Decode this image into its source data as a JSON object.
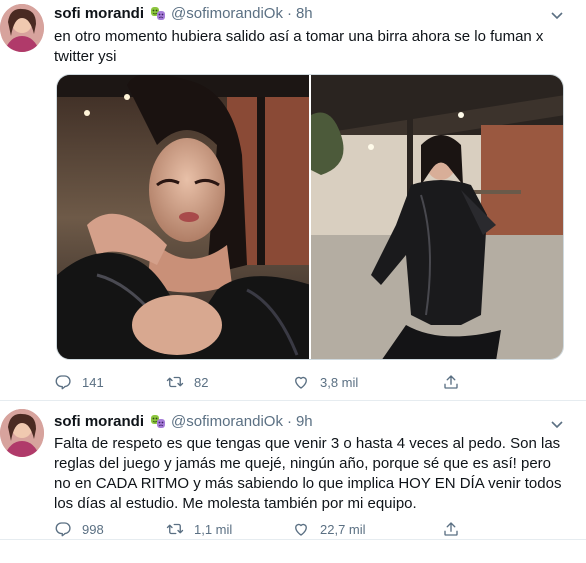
{
  "tweets": [
    {
      "author_name": "sofi morandi",
      "author_handle": "@sofimorandiOk",
      "separator": "·",
      "time": "8h",
      "text": "en otro momento hubiera salido así a tomar una birra ahora se lo fuman x twitter ysi",
      "replies": "141",
      "retweets": "82",
      "likes": "3,8 mil"
    },
    {
      "author_name": "sofi morandi",
      "author_handle": "@sofimorandiOk",
      "separator": "·",
      "time": "9h",
      "text": "Falta de respeto es que tengas que venir 3 o hasta 4 veces al pedo. Son las reglas del juego y jamás me quejé, ningún año, porque sé que es así! pero no en CADA RITMO y más sabiendo lo que implica HOY EN DÍA venir todos los días  al estudio. Me molesta también por mi equipo.",
      "replies": "998",
      "retweets": "1,1 mil",
      "likes": "22,7 mil"
    }
  ],
  "icons": {
    "emoji": "theater-masks-icon",
    "caret": "chevron-down-icon",
    "reply": "reply-icon",
    "retweet": "retweet-icon",
    "like": "heart-icon",
    "share": "share-icon"
  },
  "colors": {
    "text": "#0f1419",
    "secondary": "#5b7083",
    "divider": "#e6ecf0"
  }
}
